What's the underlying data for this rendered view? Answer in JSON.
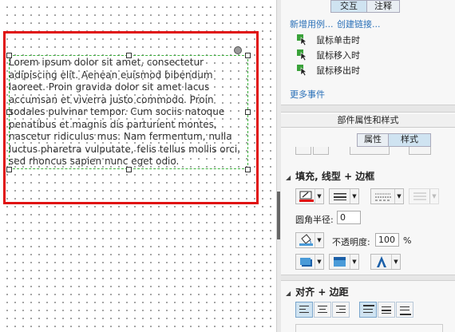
{
  "canvas": {
    "lorem_text": "Lorem ipsum dolor sit amet, consectetur adipiscing elit. Aenean euismod bibendum laoreet. Proin gravida dolor sit amet lacus accumsan et viverra justo commodo. Proin sodales pulvinar tempor. Cum sociis natoque penatibus et magnis dis parturient montes, nascetur ridiculus mus. Nam fermentum, nulla luctus pharetra vulputate, felis tellus mollis orci, sed rhoncus sapien nunc eget odio."
  },
  "interactions": {
    "tab_interaction": "交互",
    "tab_notes": "注释",
    "new_case_link": "新增用例...",
    "create_link": "创建链接...",
    "events": [
      "鼠标单击时",
      "鼠标移入时",
      "鼠标移出时"
    ],
    "more_events": "更多事件"
  },
  "properties": {
    "header": "部件属性和样式",
    "tab_props": "属性",
    "tab_style": "样式"
  },
  "fill_section": {
    "title": "填充, 线型 + 边框",
    "corner_radius_label": "圆角半径:",
    "corner_radius_value": "0",
    "opacity_label": "不透明度:",
    "opacity_value": "100",
    "opacity_unit": "%"
  },
  "align_section": {
    "title": "对齐 + 边距"
  },
  "colors": {
    "accent_red": "#e01010",
    "selection_green": "#3ab03a",
    "link_blue": "#2a70b8"
  }
}
